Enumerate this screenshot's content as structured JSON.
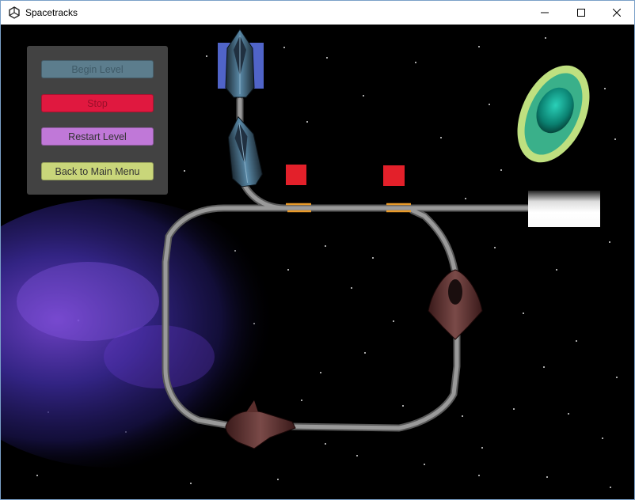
{
  "window": {
    "title": "Spacetracks",
    "min_icon": "minimize-icon",
    "max_icon": "maximize-icon",
    "close_icon": "close-icon"
  },
  "menu": {
    "begin_label": "Begin Level",
    "stop_label": "Stop",
    "restart_label": "Restart Level",
    "main_menu_label": "Back to Main Menu"
  },
  "colors": {
    "begin": "#5c7d8d",
    "stop": "#e0183f",
    "restart": "#c078d8",
    "main_menu": "#c9d67a",
    "signal": "#e3202a",
    "switch": "#e89a2a",
    "track": "#8a8a8a"
  }
}
